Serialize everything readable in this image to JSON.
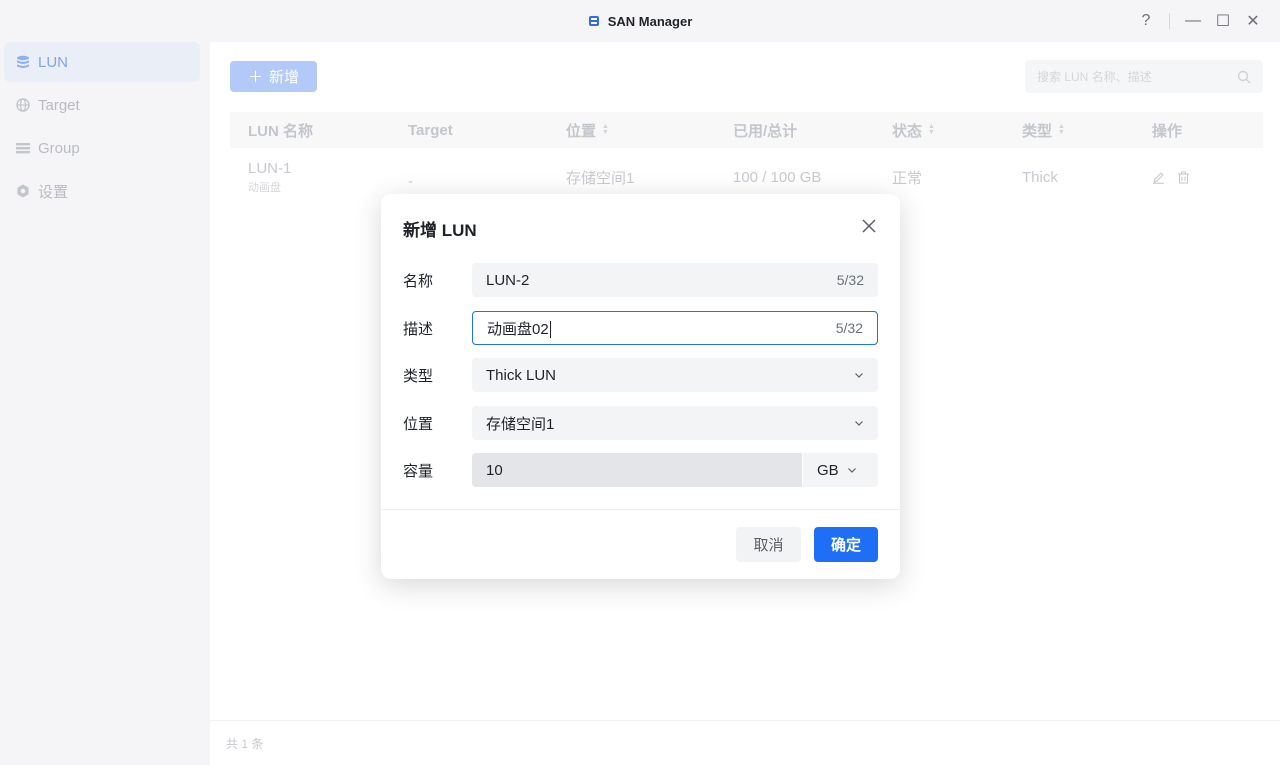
{
  "window": {
    "title": "SAN Manager",
    "controls": {
      "help": "?",
      "minimize": "—",
      "maximize": "☐",
      "close": "✕"
    }
  },
  "sidebar": {
    "items": [
      {
        "label": "LUN",
        "icon": "database-icon",
        "active": true
      },
      {
        "label": "Target",
        "icon": "globe-icon",
        "active": false
      },
      {
        "label": "Group",
        "icon": "list-icon",
        "active": false
      },
      {
        "label": "设置",
        "icon": "gear-icon",
        "active": false
      }
    ]
  },
  "toolbar": {
    "add_label": "新增",
    "add_icon": "＋",
    "search_placeholder": "搜索 LUN 名称、描述"
  },
  "table": {
    "columns": [
      "LUN 名称",
      "Target",
      "位置",
      "已用/总计",
      "状态",
      "类型",
      "操作"
    ],
    "rows": [
      {
        "name": "LUN-1",
        "desc": "动画盘",
        "target": "-",
        "location": "存储空间1",
        "usage": "100 / 100 GB",
        "status": "正常",
        "type": "Thick"
      }
    ],
    "footer": "共 1 条"
  },
  "dialog": {
    "title": "新增 LUN",
    "fields": {
      "name": {
        "label": "名称",
        "value": "LUN-2",
        "count": "5/32"
      },
      "desc": {
        "label": "描述",
        "value": "动画盘02",
        "count": "5/32"
      },
      "type": {
        "label": "类型",
        "value": "Thick LUN"
      },
      "location": {
        "label": "位置",
        "value": "存储空间1"
      },
      "capacity": {
        "label": "容量",
        "value": "10",
        "unit": "GB"
      }
    },
    "cancel_label": "取消",
    "ok_label": "确定"
  },
  "colors": {
    "accent": "#1e6ff5",
    "accent_faded": "#b3c9f7",
    "sidebar_bg": "#f5f5f7"
  }
}
